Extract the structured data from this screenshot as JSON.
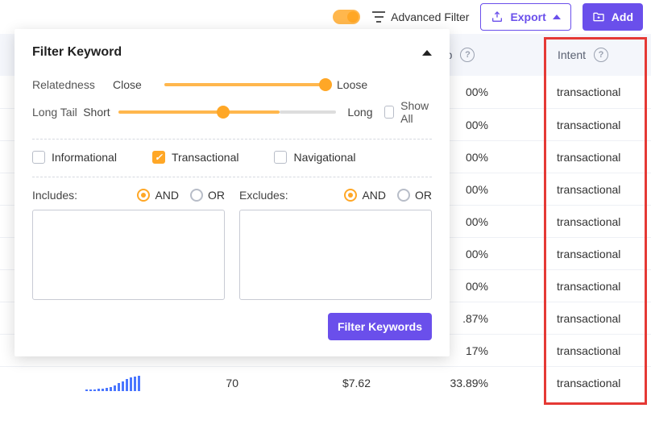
{
  "toolbar": {
    "advanced_filter_label": "Advanced Filter",
    "export_label": "Export",
    "add_label": "Add"
  },
  "table": {
    "headers": {
      "comp": "mp",
      "intent": "Intent"
    },
    "rows": [
      {
        "comp": "00%",
        "intent": "transactional"
      },
      {
        "comp": "00%",
        "intent": "transactional"
      },
      {
        "comp": "00%",
        "intent": "transactional"
      },
      {
        "comp": "00%",
        "intent": "transactional"
      },
      {
        "comp": "00%",
        "intent": "transactional"
      },
      {
        "comp": "00%",
        "intent": "transactional"
      },
      {
        "comp": "00%",
        "intent": "transactional"
      },
      {
        "comp": ".87%",
        "intent": "transactional"
      },
      {
        "comp": "17%",
        "intent": "transactional"
      },
      {
        "comp": "33.89%",
        "intent": "transactional",
        "volume": "70",
        "cpc": "$7.62",
        "spark": [
          2,
          2,
          2,
          3,
          3,
          4,
          5,
          7,
          10,
          12,
          15,
          17,
          18,
          19
        ]
      }
    ]
  },
  "panel": {
    "title": "Filter Keyword",
    "relatedness_label": "Relatedness",
    "relatedness_left": "Close",
    "relatedness_right": "Loose",
    "longtail_label": "Long Tail",
    "longtail_left": "Short",
    "longtail_right": "Long",
    "showall_label": "Show All",
    "informational_label": "Informational",
    "transactional_label": "Transactional",
    "navigational_label": "Navigational",
    "includes_label": "Includes:",
    "excludes_label": "Excludes:",
    "and_label": "AND",
    "or_label": "OR",
    "submit_label": "Filter Keywords"
  }
}
